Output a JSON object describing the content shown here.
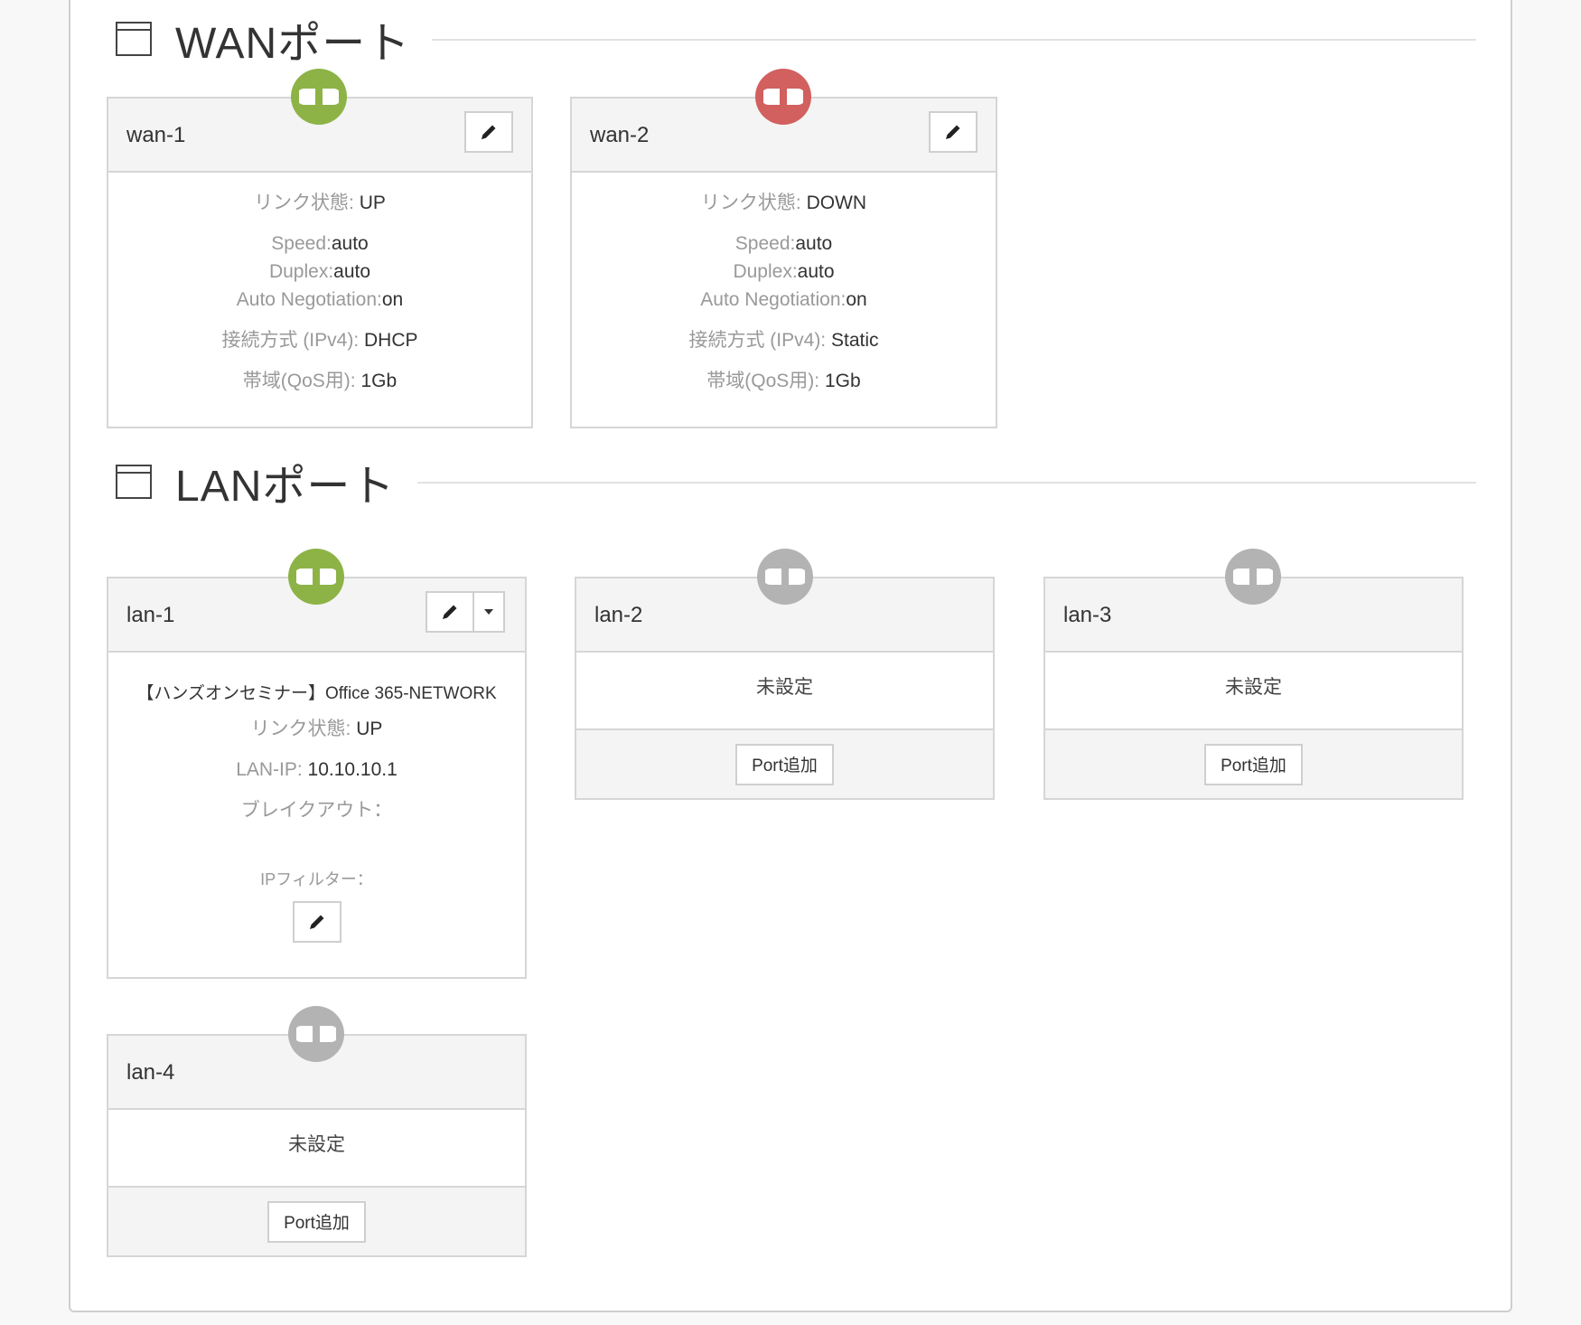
{
  "colors": {
    "up": "#8db346",
    "down": "#d1605f",
    "unset": "#b3b3b3"
  },
  "wan_section": {
    "title": "WANポート"
  },
  "lan_section": {
    "title": "LANポート"
  },
  "wan": [
    {
      "name": "wan-1",
      "status_color": "up",
      "link_label": "リンク状態: ",
      "link_value": "UP",
      "speed_label": "Speed:",
      "speed_value": "auto",
      "duplex_label": "Duplex:",
      "duplex_value": "auto",
      "autoneg_label": "Auto Negotiation:",
      "autoneg_value": "on",
      "conn_label": "接続方式 (IPv4): ",
      "conn_value": "DHCP",
      "bw_label": "帯域(QoS用): ",
      "bw_value": "1Gb"
    },
    {
      "name": "wan-2",
      "status_color": "down",
      "link_label": "リンク状態: ",
      "link_value": "DOWN",
      "speed_label": "Speed:",
      "speed_value": "auto",
      "duplex_label": "Duplex:",
      "duplex_value": "auto",
      "autoneg_label": "Auto Negotiation:",
      "autoneg_value": "on",
      "conn_label": "接続方式 (IPv4): ",
      "conn_value": "Static",
      "bw_label": "帯域(QoS用): ",
      "bw_value": "1Gb"
    }
  ],
  "lan1": {
    "name": "lan-1",
    "status_color": "up",
    "network": "【ハンズオンセミナー】Office 365-NETWORK",
    "link_label": "リンク状態: ",
    "link_value": "UP",
    "ip_label": "LAN-IP: ",
    "ip_value": "10.10.10.1",
    "breakout_label": "ブレイクアウト：",
    "ipfilter_label": "IPフィルター："
  },
  "lan_unset": [
    {
      "name": "lan-2",
      "status_text": "未設定",
      "button": "Port追加"
    },
    {
      "name": "lan-3",
      "status_text": "未設定",
      "button": "Port追加"
    },
    {
      "name": "lan-4",
      "status_text": "未設定",
      "button": "Port追加"
    }
  ],
  "icons": {
    "port_status": "plug-icon",
    "edit": "pencil-icon",
    "dropdown": "caret-down-icon",
    "section": "window-icon"
  }
}
